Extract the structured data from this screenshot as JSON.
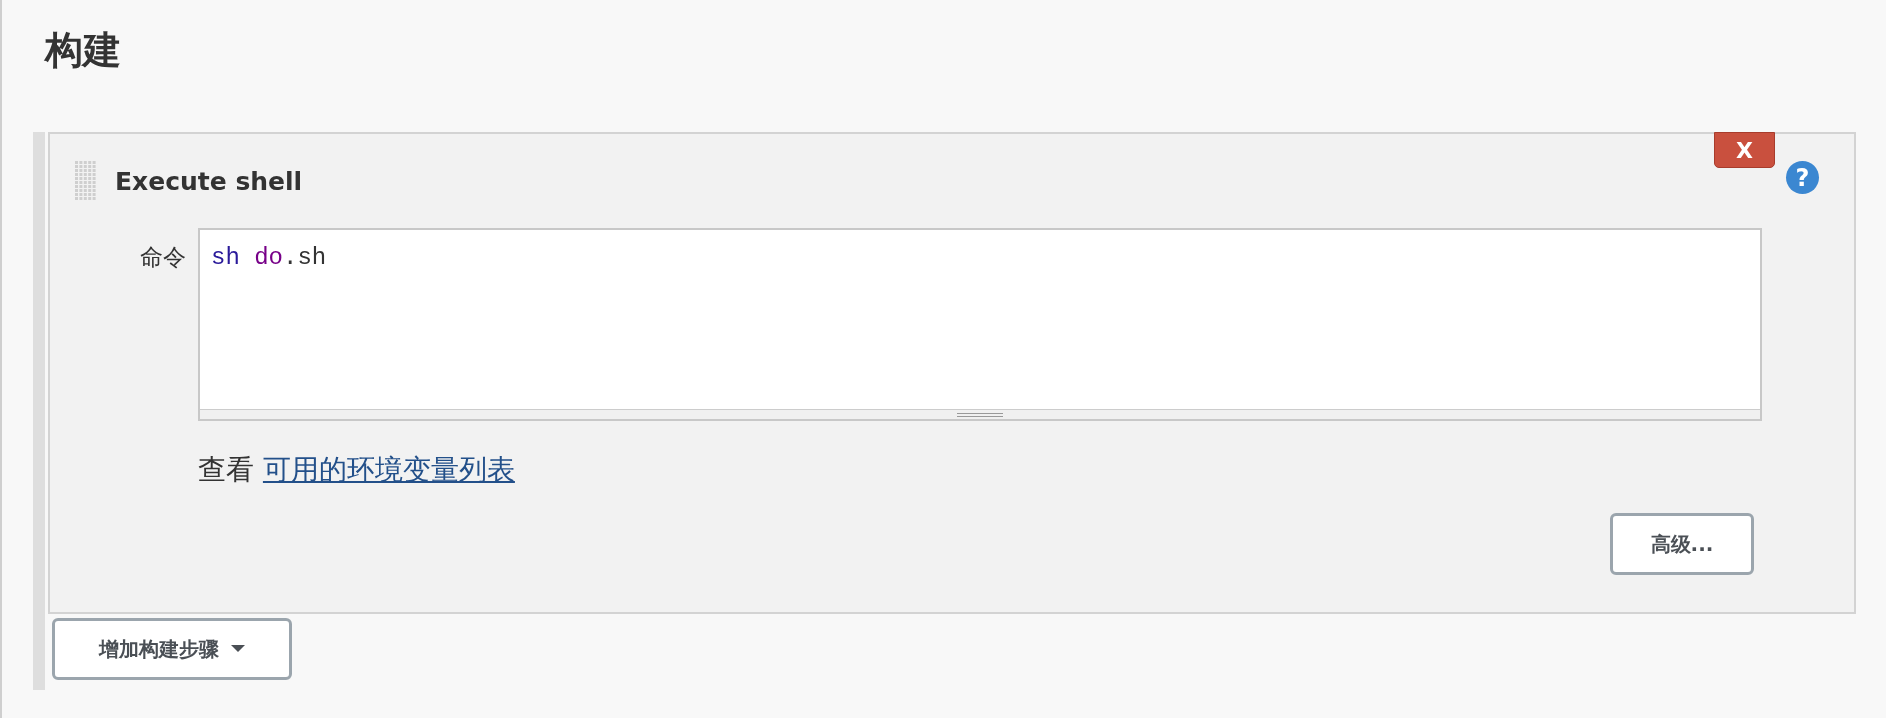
{
  "section": {
    "title": "构建"
  },
  "build_step": {
    "title": "Execute shell",
    "delete_label": "X",
    "help_label": "?",
    "command": {
      "label": "命令",
      "tokens": [
        {
          "text": "sh ",
          "kind": "builtin"
        },
        {
          "text": "do",
          "kind": "keyword"
        },
        {
          "text": ".sh",
          "kind": "plain"
        }
      ]
    },
    "hint": {
      "prefix": "查看",
      "link": "可用的环境变量列表"
    },
    "advanced_button": "高级..."
  },
  "add_step_button": "增加构建步骤"
}
